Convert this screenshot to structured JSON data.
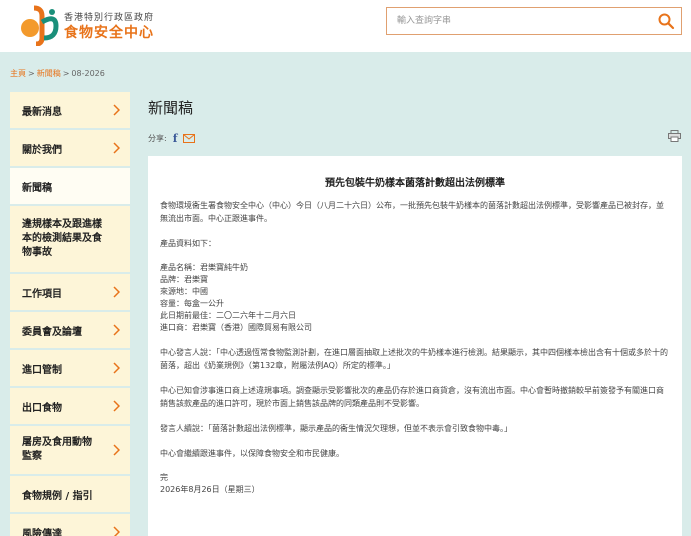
{
  "header": {
    "dept_name": "香港特別行政區政府",
    "site_name": "食物安全中心",
    "search_placeholder": "輸入查詢字串"
  },
  "breadcrumb": {
    "home": "主頁",
    "section": "新聞稿",
    "current": "08-2026",
    "sep": ">"
  },
  "sidebar": {
    "items": [
      {
        "label": "最新消息",
        "chevron": true
      },
      {
        "label": "關於我們",
        "chevron": true
      },
      {
        "label": "新聞稿",
        "chevron": false
      },
      {
        "label": "違規樣本及跟進樣本的檢測結果及食物事故",
        "chevron": false
      },
      {
        "label": "工作項目",
        "chevron": true
      },
      {
        "label": "委員會及論壇",
        "chevron": true
      },
      {
        "label": "進口管制",
        "chevron": true
      },
      {
        "label": "出口食物",
        "chevron": true
      },
      {
        "label": "屠房及食用動物監察",
        "chevron": true
      },
      {
        "label": "食物規例 / 指引",
        "chevron": false
      },
      {
        "label": "風險傳達",
        "chevron": true
      }
    ]
  },
  "main": {
    "page_title": "新聞稿",
    "share_label": "分享:",
    "article": {
      "title": "預先包裝牛奶樣本菌落計數超出法例標準",
      "p1": "食物環境衞生署食物安全中心（中心）今日（八月二十六日）公布，一批預先包裝牛奶樣本的菌落計數超出法例標準，受影響產品已被封存，並無流出市面。中心正跟進事件。",
      "p2": "產品資料如下：",
      "details": [
        "產品名稱：君樂寶純牛奶",
        "品牌：君樂寶",
        "來源地：中國",
        "容量：每盒一公升",
        "此日期前最佳：二〇二六年十二月六日",
        "進口商：君樂寶（香港）國際貿易有限公司"
      ],
      "p3": "中心發言人說：「中心透過恆常食物監測計劃，在進口層面抽取上述批次的牛奶樣本進行檢測。結果顯示，其中四個樣本檢出含有十個或多於十的菌落，超出《奶業規例》（第132章，附屬法例AQ）所定的標準。」",
      "p4": "中心已知會涉事進口商上述違規事項。調查顯示受影響批次的產品仍存於進口商貨倉，沒有流出市面。中心會暫時撤銷較早前簽發予有關進口商銷售該款產品的進口許可，現於市面上銷售該品牌的同類產品則不受影響。",
      "p5": "發言人續說：「菌落計數超出法例標準，顯示產品的衞生情況欠理想，但並不表示會引致食物中毒。」",
      "p6": "中心會繼續跟進事件，以保障食物安全和市民健康。",
      "end": "完",
      "date": "2026年8月26日（星期三）"
    }
  },
  "colors": {
    "accent": "#e8731a",
    "sidebar_bg": "#fdf5d8",
    "page_bg": "#d9ecea",
    "logo_orange": "#f39a2c",
    "logo_green": "#1a8f7a"
  }
}
